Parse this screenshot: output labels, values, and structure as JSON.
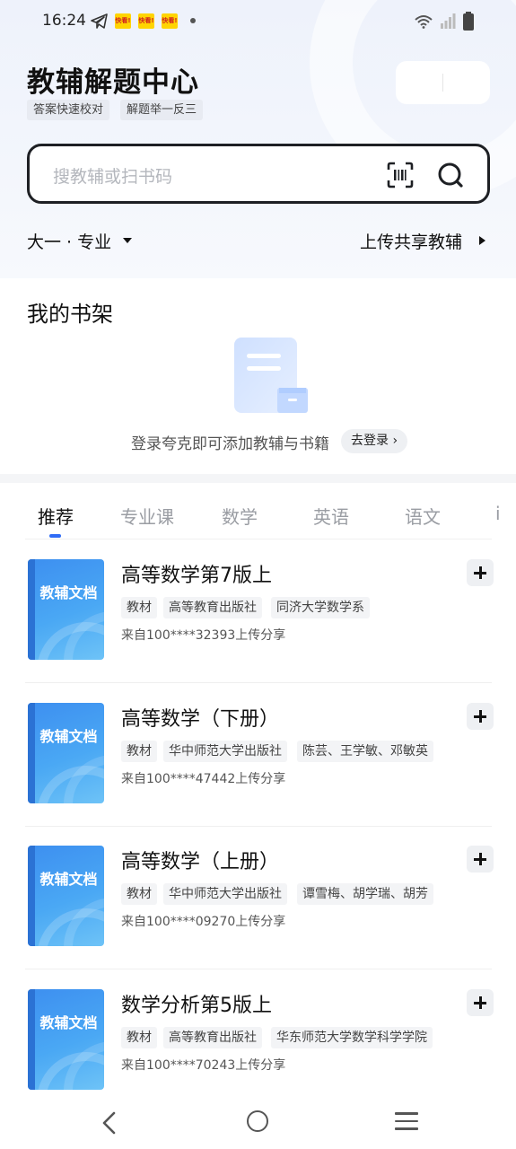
{
  "status_bar": {
    "time": "16:24",
    "notifications": [
      "快看!",
      "快看!",
      "快看!"
    ]
  },
  "header": {
    "title": "教辅解题中心",
    "tags": [
      "答案快速校对",
      "解题举一反三"
    ]
  },
  "search": {
    "placeholder": "搜教辅或扫书码"
  },
  "filter": {
    "grade": "大一 · 专业",
    "upload": "上传共享教辅"
  },
  "shelf": {
    "title": "我的书架",
    "login_prompt": "登录夸克即可添加教辅与书籍",
    "login_button": "去登录 ›"
  },
  "tabs": [
    "推荐",
    "专业课",
    "数学",
    "英语",
    "语文",
    "i"
  ],
  "books": [
    {
      "cover_label": "教辅文档",
      "title": "高等数学第7版上",
      "tags": [
        "教材",
        "高等教育出版社",
        "同济大学数学系"
      ],
      "source": "来自100****32393上传分享"
    },
    {
      "cover_label": "教辅文档",
      "title": "高等数学（下册）",
      "tags": [
        "教材",
        "华中师范大学出版社",
        "陈芸、王学敏、邓敏英"
      ],
      "source": "来自100****47442上传分享"
    },
    {
      "cover_label": "教辅文档",
      "title": "高等数学（上册）",
      "tags": [
        "教材",
        "华中师范大学出版社",
        "谭雪梅、胡学瑞、胡芳"
      ],
      "source": "来自100****09270上传分享"
    },
    {
      "cover_label": "教辅文档",
      "title": "数学分析第5版上",
      "tags": [
        "教材",
        "高等教育出版社",
        "华东师范大学数学科学学院"
      ],
      "source": "来自100****70243上传分享"
    }
  ],
  "colors": {
    "accent": "#2f6cf6",
    "cover_blue": "#3d8ff0"
  }
}
